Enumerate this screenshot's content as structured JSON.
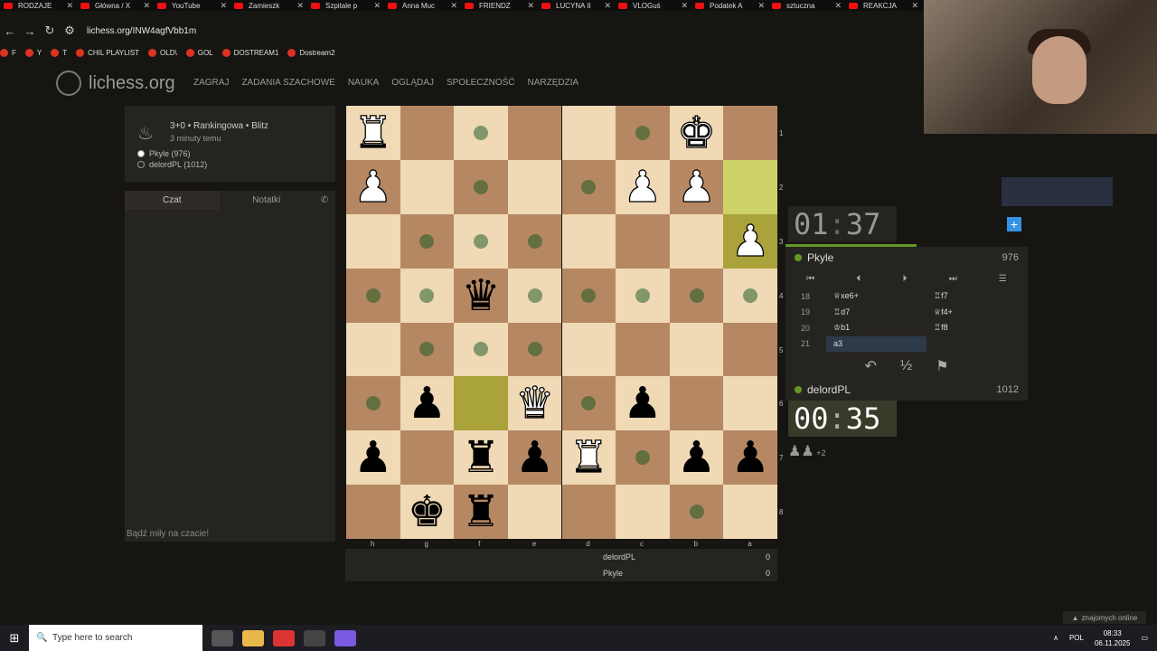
{
  "browser": {
    "tabs": [
      "RODZAJE",
      "Główna / X",
      "YouTube",
      "Zamieszk",
      "Szpitale p",
      "Anna Muc",
      "FRIENDZ",
      "LUCYNA II",
      "VLOGuś",
      "Podatek A",
      "sztuczna",
      "REAKCJA"
    ],
    "url": "lichess.org/INW4agfVbb1m",
    "bookmarks": [
      "F",
      "Y",
      "T",
      "CHIL PLAYLIST",
      "OLD\\",
      "GOL",
      "DOSTREAM1",
      "Dostream2"
    ]
  },
  "site": {
    "logo": "lichess.org",
    "nav": [
      "ZAGRAJ",
      "ZADANIA SZACHOWE",
      "NAUKA",
      "OGLĄDAJ",
      "SPOŁECZNOŚĆ",
      "NARZĘDZIA"
    ]
  },
  "game": {
    "title": "3+0 • Rankingowa • Blitz",
    "time_ago": "3 minuty temu",
    "white": "Pkyle (976)",
    "black": "delordPL (1012)"
  },
  "chat": {
    "tab_chat": "Czat",
    "tab_notes": "Notatki",
    "placeholder": "Bądź miły na czacie!"
  },
  "board": {
    "files": [
      "h",
      "g",
      "f",
      "e",
      "d",
      "c",
      "b",
      "a"
    ],
    "ranks": [
      "1",
      "2",
      "3",
      "4",
      "5",
      "6",
      "7",
      "8"
    ]
  },
  "players": {
    "top_name": "Pkyle",
    "top_rating": "976",
    "top_clock_min": "01",
    "top_clock_sec": "37",
    "bottom_name": "delordPL",
    "bottom_rating": "1012",
    "bottom_clock_min": "00",
    "bottom_clock_sec": "35",
    "extra": "+2"
  },
  "moves": [
    {
      "n": "18",
      "w": "♕xe6+",
      "b": "♖f7"
    },
    {
      "n": "19",
      "w": "♖d7",
      "b": "♕f4+"
    },
    {
      "n": "20",
      "w": "♔b1",
      "b": "♖f8"
    },
    {
      "n": "21",
      "w": "a3",
      "b": ""
    }
  ],
  "score": {
    "p1_name": "delordPL",
    "p1_score": "0",
    "p2_name": "Pkyle",
    "p2_score": "0"
  },
  "status": {
    "friends": "znajomych online"
  },
  "taskbar": {
    "search": "Type here to search",
    "lang": "POL",
    "time": "08:33",
    "date": "06.11.2025"
  }
}
